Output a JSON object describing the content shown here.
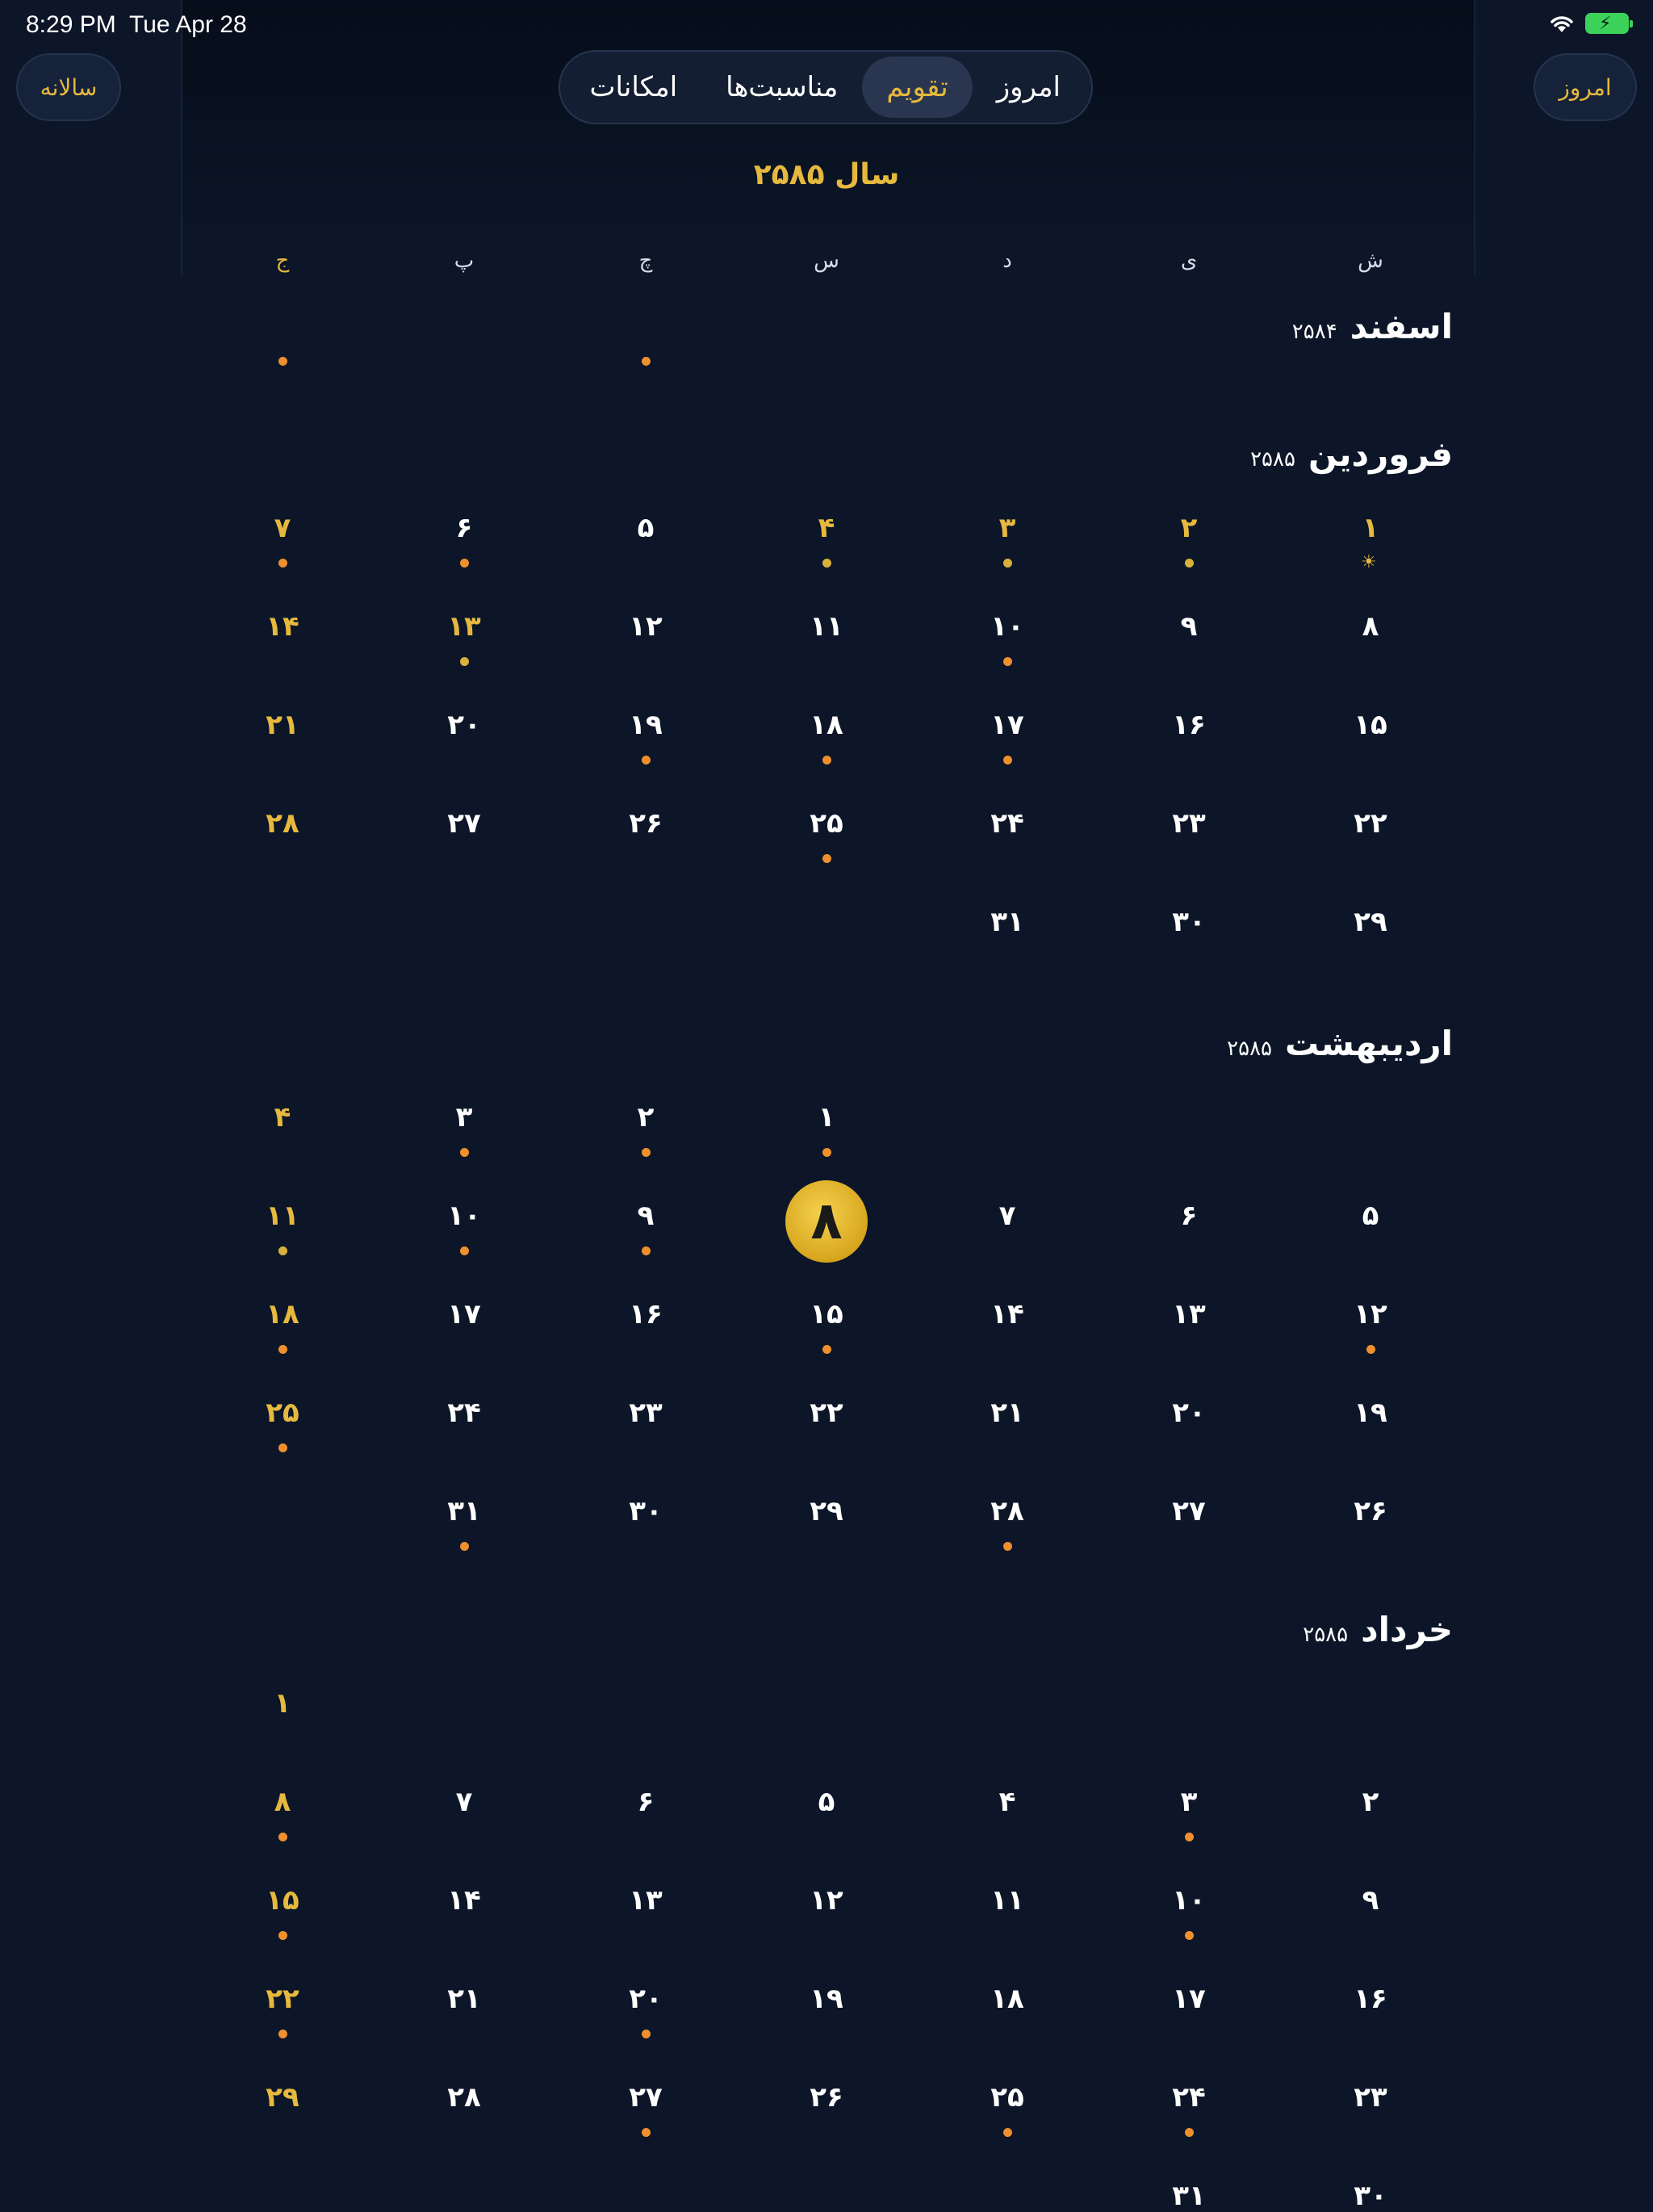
{
  "status_bar": {
    "time": "8:29 PM",
    "date": "Tue Apr 28"
  },
  "header": {
    "left_button": "سالانه",
    "right_button": "امروز",
    "tabs": [
      {
        "label": "امروز",
        "active": false
      },
      {
        "label": "تقویم",
        "active": true
      },
      {
        "label": "مناسبت‌ها",
        "active": false
      },
      {
        "label": "امکانات",
        "active": false
      }
    ]
  },
  "year_title": "سال ۲۵۸۵",
  "weekdays": [
    {
      "label": "ش",
      "holiday": false
    },
    {
      "label": "ی",
      "holiday": false
    },
    {
      "label": "د",
      "holiday": false
    },
    {
      "label": "س",
      "holiday": false
    },
    {
      "label": "چ",
      "holiday": false
    },
    {
      "label": "پ",
      "holiday": false
    },
    {
      "label": "ج",
      "holiday": true
    }
  ],
  "colors": {
    "accent": "#e6b93e",
    "event_dot": "#f08f2d",
    "background": "#0c1628"
  },
  "months": [
    {
      "name": "اسفند",
      "year": "۲۵۸۴",
      "weeks": [
        [
          null,
          null,
          null,
          null,
          {
            "t": "",
            "dot": "o"
          },
          null,
          {
            "t": "",
            "dot": "o"
          }
        ]
      ]
    },
    {
      "name": "فروردین",
      "year": "۲۵۸۵",
      "weeks": [
        [
          {
            "t": "۱",
            "h": 1,
            "sun": 1
          },
          {
            "t": "۲",
            "h": 1,
            "dot": "y"
          },
          {
            "t": "۳",
            "h": 1,
            "dot": "y"
          },
          {
            "t": "۴",
            "h": 1,
            "dot": "y"
          },
          {
            "t": "۵"
          },
          {
            "t": "۶",
            "dot": "o"
          },
          {
            "t": "۷",
            "h": 1,
            "dot": "o"
          }
        ],
        [
          {
            "t": "۸"
          },
          {
            "t": "۹"
          },
          {
            "t": "۱۰",
            "dot": "o"
          },
          {
            "t": "۱۱"
          },
          {
            "t": "۱۲"
          },
          {
            "t": "۱۳",
            "h": 1,
            "dot": "y"
          },
          {
            "t": "۱۴",
            "h": 1
          }
        ],
        [
          {
            "t": "۱۵"
          },
          {
            "t": "۱۶"
          },
          {
            "t": "۱۷",
            "dot": "o"
          },
          {
            "t": "۱۸",
            "dot": "o"
          },
          {
            "t": "۱۹",
            "dot": "o"
          },
          {
            "t": "۲۰"
          },
          {
            "t": "۲۱",
            "h": 1
          }
        ],
        [
          {
            "t": "۲۲"
          },
          {
            "t": "۲۳"
          },
          {
            "t": "۲۴"
          },
          {
            "t": "۲۵",
            "dot": "o"
          },
          {
            "t": "۲۶"
          },
          {
            "t": "۲۷"
          },
          {
            "t": "۲۸",
            "h": 1
          }
        ],
        [
          {
            "t": "۲۹"
          },
          {
            "t": "۳۰"
          },
          {
            "t": "۳۱"
          },
          null,
          null,
          null,
          null
        ]
      ]
    },
    {
      "name": "اردیبهشت",
      "year": "۲۵۸۵",
      "weeks": [
        [
          null,
          null,
          null,
          {
            "t": "۱",
            "dot": "o"
          },
          {
            "t": "۲",
            "dot": "o"
          },
          {
            "t": "۳",
            "dot": "o"
          },
          {
            "t": "۴",
            "h": 1
          }
        ],
        [
          {
            "t": "۵"
          },
          {
            "t": "۶"
          },
          {
            "t": "۷"
          },
          {
            "t": "۸",
            "today": 1
          },
          {
            "t": "۹",
            "dot": "o"
          },
          {
            "t": "۱۰",
            "dot": "o"
          },
          {
            "t": "۱۱",
            "h": 1,
            "dot": "y"
          }
        ],
        [
          {
            "t": "۱۲",
            "dot": "o"
          },
          {
            "t": "۱۳"
          },
          {
            "t": "۱۴"
          },
          {
            "t": "۱۵",
            "dot": "o"
          },
          {
            "t": "۱۶"
          },
          {
            "t": "۱۷"
          },
          {
            "t": "۱۸",
            "h": 1,
            "dot": "o"
          }
        ],
        [
          {
            "t": "۱۹"
          },
          {
            "t": "۲۰"
          },
          {
            "t": "۲۱"
          },
          {
            "t": "۲۲"
          },
          {
            "t": "۲۳"
          },
          {
            "t": "۲۴"
          },
          {
            "t": "۲۵",
            "h": 1,
            "dot": "o"
          }
        ],
        [
          {
            "t": "۲۶"
          },
          {
            "t": "۲۷"
          },
          {
            "t": "۲۸",
            "dot": "o"
          },
          {
            "t": "۲۹"
          },
          {
            "t": "۳۰"
          },
          {
            "t": "۳۱",
            "dot": "o"
          },
          null
        ]
      ]
    },
    {
      "name": "خرداد",
      "year": "۲۵۸۵",
      "weeks": [
        [
          null,
          null,
          null,
          null,
          null,
          null,
          {
            "t": "۱",
            "h": 1
          }
        ],
        [
          {
            "t": "۲"
          },
          {
            "t": "۳",
            "dot": "o"
          },
          {
            "t": "۴"
          },
          {
            "t": "۵"
          },
          {
            "t": "۶"
          },
          {
            "t": "۷"
          },
          {
            "t": "۸",
            "h": 1,
            "dot": "o"
          }
        ],
        [
          {
            "t": "۹"
          },
          {
            "t": "۱۰",
            "dot": "o"
          },
          {
            "t": "۱۱"
          },
          {
            "t": "۱۲"
          },
          {
            "t": "۱۳"
          },
          {
            "t": "۱۴"
          },
          {
            "t": "۱۵",
            "h": 1,
            "dot": "o"
          }
        ],
        [
          {
            "t": "۱۶"
          },
          {
            "t": "۱۷"
          },
          {
            "t": "۱۸"
          },
          {
            "t": "۱۹"
          },
          {
            "t": "۲۰",
            "dot": "o"
          },
          {
            "t": "۲۱"
          },
          {
            "t": "۲۲",
            "h": 1,
            "dot": "o"
          }
        ],
        [
          {
            "t": "۲۳"
          },
          {
            "t": "۲۴",
            "dot": "o"
          },
          {
            "t": "۲۵",
            "dot": "o"
          },
          {
            "t": "۲۶"
          },
          {
            "t": "۲۷",
            "dot": "o"
          },
          {
            "t": "۲۸"
          },
          {
            "t": "۲۹",
            "h": 1
          }
        ],
        [
          {
            "t": "۳۰"
          },
          {
            "t": "۳۱"
          },
          null,
          null,
          null,
          null,
          null
        ]
      ]
    }
  ]
}
